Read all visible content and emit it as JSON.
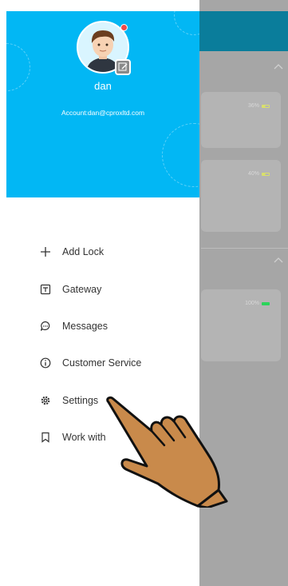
{
  "background": {
    "cards": [
      {
        "battery": "36%",
        "battery_icon": "battery-yellow-icon"
      },
      {
        "battery": "40%",
        "battery_icon": "battery-yellow-icon"
      },
      {
        "battery": "100%",
        "battery_icon": "battery-green-icon"
      }
    ]
  },
  "drawer": {
    "user_name": "dan",
    "account": "Account:dan@cproxltd.com",
    "menu": [
      {
        "label": "Add Lock",
        "icon": "plus-icon"
      },
      {
        "label": "Gateway",
        "icon": "gateway-icon"
      },
      {
        "label": "Messages",
        "icon": "chat-icon"
      },
      {
        "label": "Customer Service",
        "icon": "info-icon"
      },
      {
        "label": "Settings",
        "icon": "gear-icon"
      },
      {
        "label": "Work with",
        "icon": "bookmark-icon"
      }
    ]
  },
  "colors": {
    "header": "#02b7f4",
    "bg_header": "#0a7d9b",
    "overlay": "#a6a6a6"
  }
}
